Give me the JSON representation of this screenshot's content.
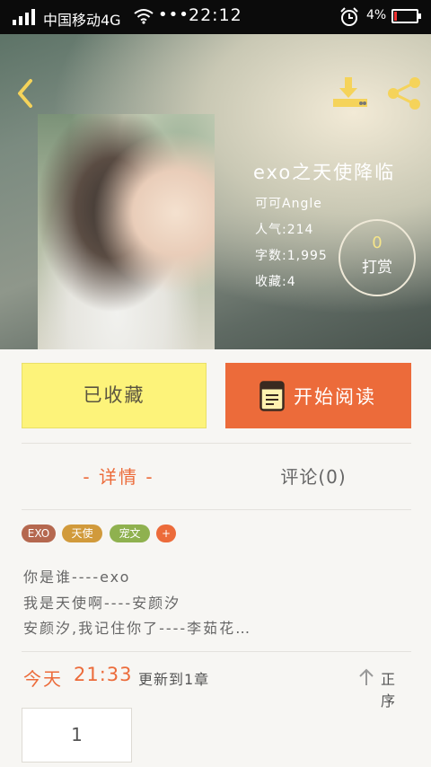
{
  "status_bar": {
    "carrier": "中国移动4G",
    "dots": "•••",
    "time": "22:12",
    "battery_pct": "4%",
    "battery_level": 0.04
  },
  "header": {
    "icons": [
      "back-arrow-icon",
      "download-icon",
      "share-icon"
    ],
    "icon_color": "#f5d35a"
  },
  "book": {
    "title": "exo之天使降临",
    "author": "可可Angle",
    "popularity": "人气:214",
    "word_count": "字数:1,995",
    "favorites": "收藏:4"
  },
  "tip": {
    "amount": "0",
    "label": "打赏"
  },
  "actions": {
    "favorited_label": "已收藏",
    "read_label": "开始阅读",
    "read_color": "#ec6b3a",
    "favorited_color": "#fdf37a"
  },
  "tabs": {
    "details": "- 详情 -",
    "comments": "评论(0)"
  },
  "tags": [
    {
      "label": "EXO",
      "color": "#b5684f"
    },
    {
      "label": "天使",
      "color": "#d19a3b"
    },
    {
      "label": "宠文",
      "color": "#8fb14f"
    },
    {
      "label": "+",
      "color": "#ec6b3a"
    }
  ],
  "description": [
    "你是谁----exo",
    "我是天使啊----安颜汐",
    "安颜汐,我记住你了----李茹花…"
  ],
  "update": {
    "day": "今天",
    "time": "21:33",
    "text": "更新到1章",
    "sort_label": "正序"
  },
  "chapters": [
    "1"
  ]
}
